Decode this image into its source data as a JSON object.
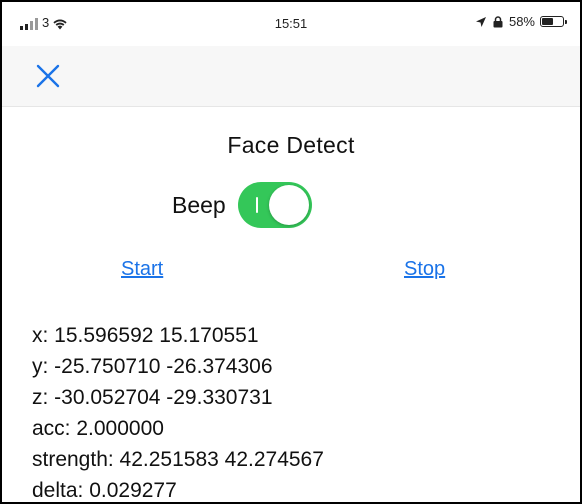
{
  "status_bar": {
    "carrier": "3",
    "time": "15:51",
    "battery_percent": "58%",
    "battery_level": 0.58
  },
  "nav": {
    "close_icon": "close-x-icon",
    "accent_color": "#1a73e8"
  },
  "main": {
    "title": "Face Detect",
    "beep_label": "Beep",
    "beep_toggle_on": true,
    "toggle_color": "#34c759",
    "start_label": "Start",
    "stop_label": "Stop"
  },
  "readouts": [
    "x: 15.596592 15.170551",
    "y: -25.750710 -26.374306",
    "z: -30.052704 -29.330731",
    "acc: 2.000000",
    "strength: 42.251583 42.274567",
    "delta: 0.029277"
  ]
}
